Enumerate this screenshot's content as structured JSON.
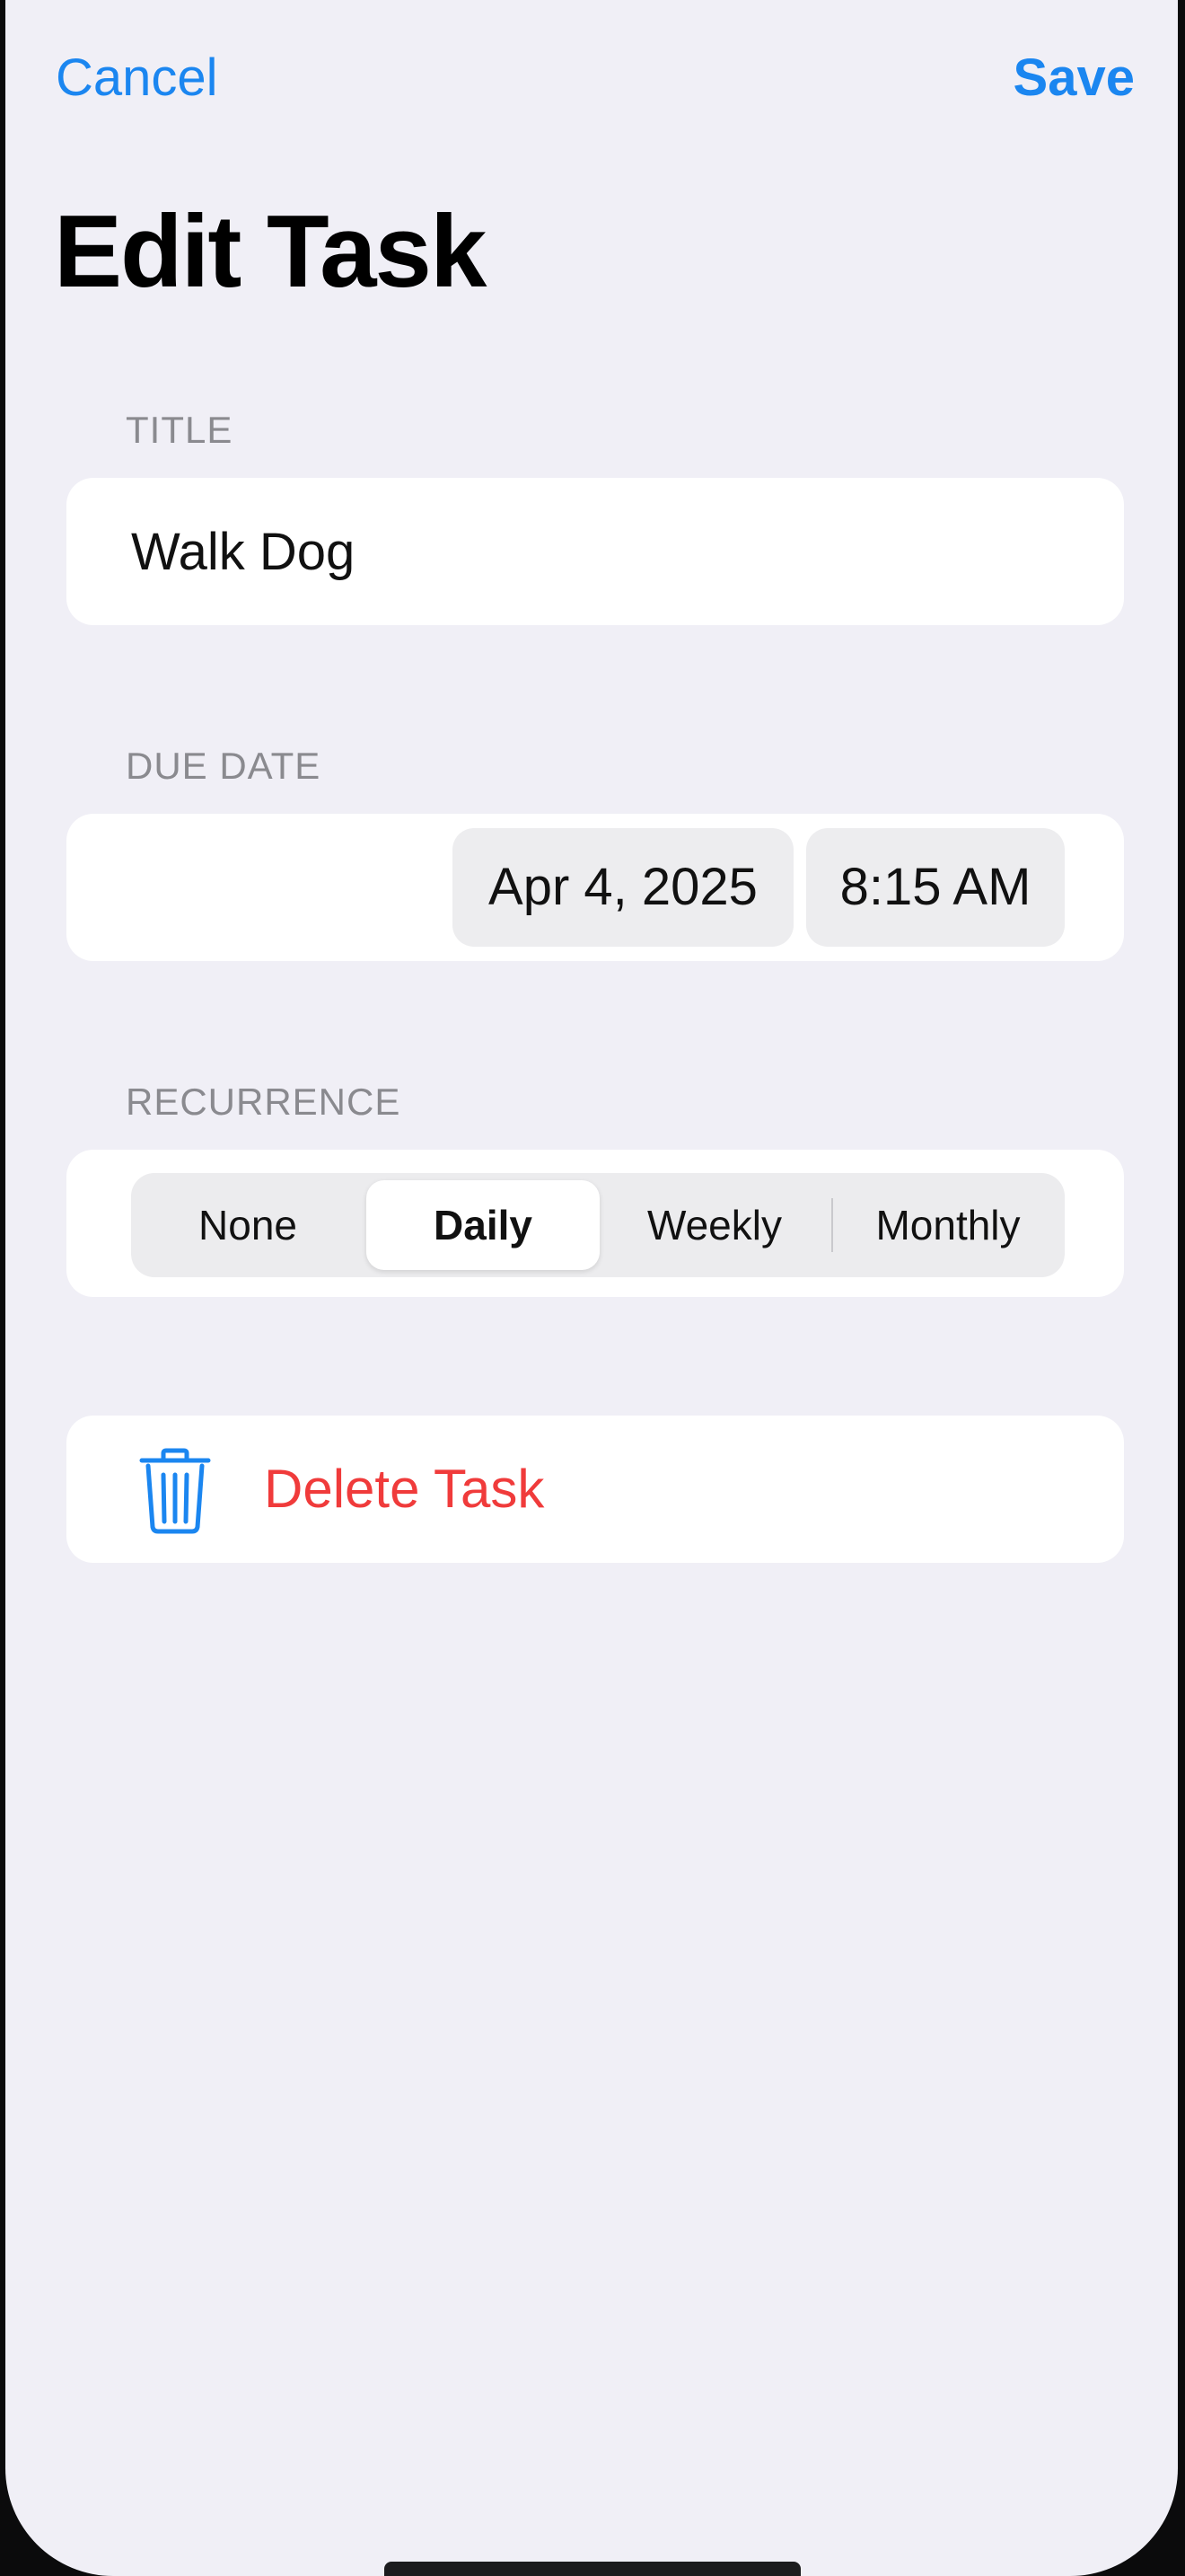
{
  "nav": {
    "cancel_label": "Cancel",
    "save_label": "Save"
  },
  "page": {
    "title": "Edit Task"
  },
  "title_section": {
    "label": "TITLE",
    "value": "Walk Dog"
  },
  "due_date_section": {
    "label": "DUE DATE",
    "date": "Apr 4, 2025",
    "time": "8:15 AM"
  },
  "recurrence_section": {
    "label": "RECURRENCE",
    "options": [
      "None",
      "Daily",
      "Weekly",
      "Monthly"
    ],
    "selected": "Daily"
  },
  "delete": {
    "label": "Delete Task",
    "icon": "trash-icon"
  },
  "colors": {
    "accent": "#1b86f0",
    "destructive": "#f03b3b",
    "background": "#f0eff6",
    "card": "#ffffff"
  }
}
